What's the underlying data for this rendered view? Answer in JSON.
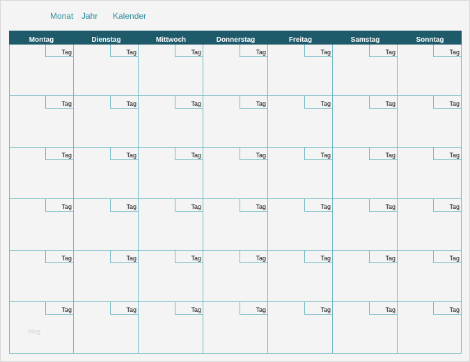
{
  "title": {
    "month": "Monat",
    "year": "Jahr",
    "calendar": "Kalender"
  },
  "weekdays": [
    "Montag",
    "Dienstag",
    "Mittwoch",
    "Donnerstag",
    "Freitag",
    "Samstag",
    "Sonntag"
  ],
  "day_label": "Tag",
  "weeks": 6,
  "colors": {
    "header_bg": "#1e5a6a",
    "grid_line": "#6fb8c4",
    "title_text": "#2c8ea0",
    "page_bg": "#f4f4f4"
  },
  "watermark": "blog"
}
